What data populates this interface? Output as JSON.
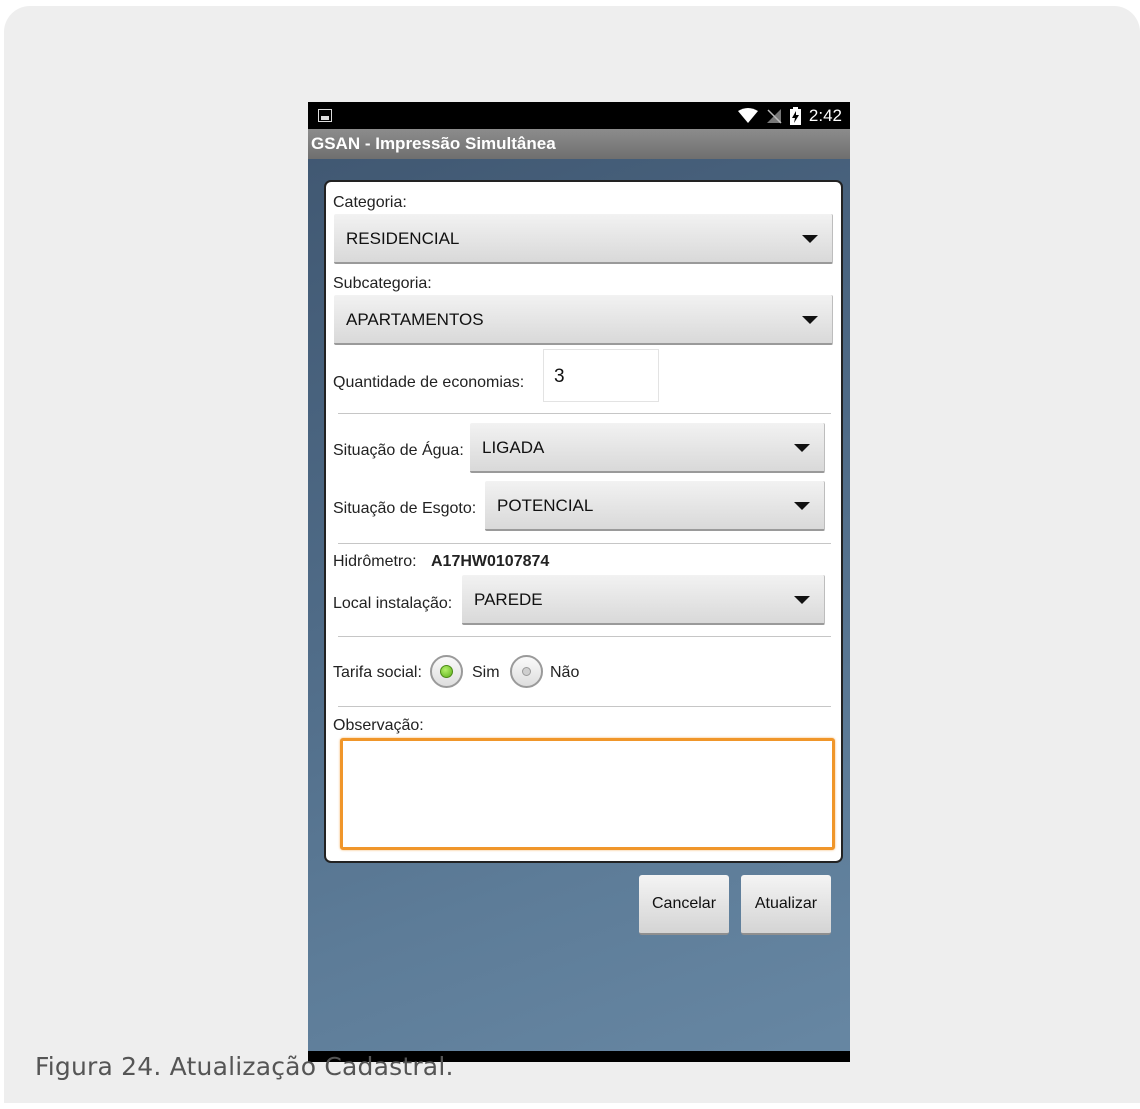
{
  "caption": "Figura 24. Atualização Cadastral.",
  "status_bar": {
    "time": "2:42"
  },
  "app": {
    "title": "GSAN - Impressão Simultânea"
  },
  "form": {
    "categoria_label": "Categoria:",
    "categoria_value": "RESIDENCIAL",
    "subcategoria_label": "Subcategoria:",
    "subcategoria_value": "APARTAMENTOS",
    "quantidade_label": "Quantidade de economias:",
    "quantidade_value": "3",
    "agua_label": "Situação de Água:",
    "agua_value": "LIGADA",
    "esgoto_label": "Situação de Esgoto:",
    "esgoto_value": "POTENCIAL",
    "hidrometro_label": "Hidrômetro:",
    "hidrometro_value": "A17HW0107874",
    "local_label": "Local instalação:",
    "local_value": "PAREDE",
    "tarifa_label": "Tarifa social:",
    "tarifa_options": [
      "Sim",
      "Não"
    ],
    "tarifa_selected": "Sim",
    "observacao_label": "Observação:",
    "observacao_value": ""
  },
  "buttons": {
    "cancel": "Cancelar",
    "update": "Atualizar"
  },
  "colors": {
    "focus_border": "#f0962a",
    "radio_selected": "#5cb01a",
    "titlebar": "#7a7a7a"
  }
}
